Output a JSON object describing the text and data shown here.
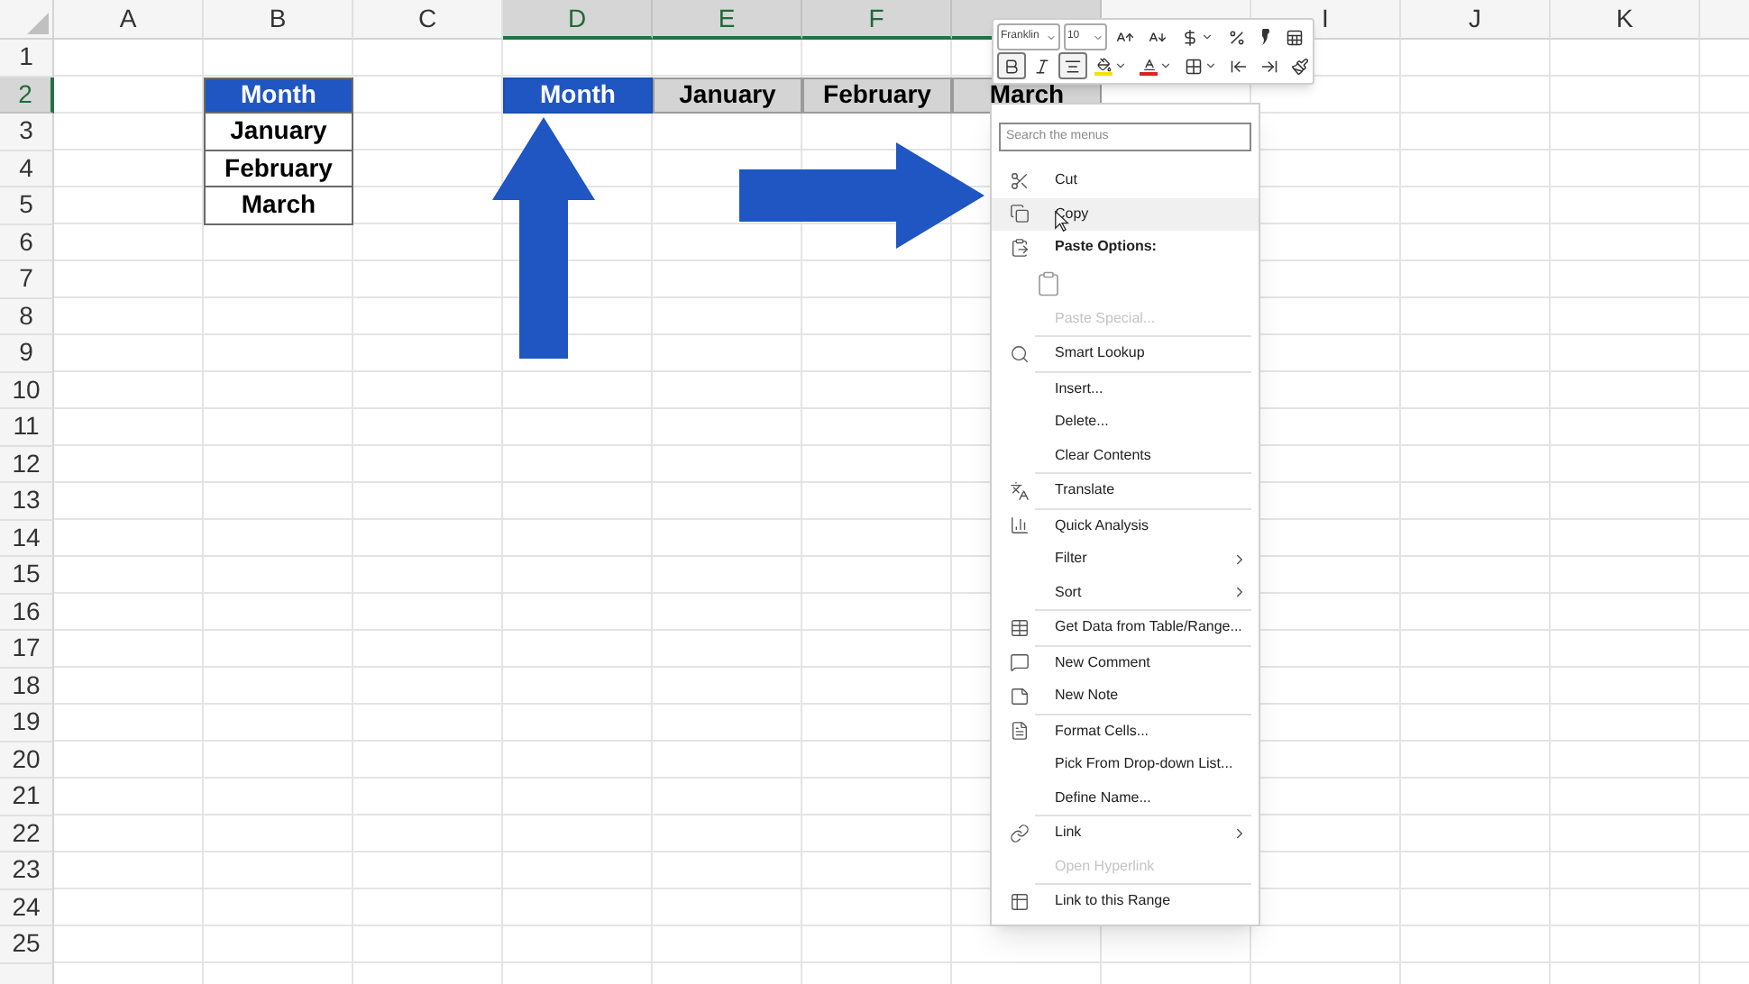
{
  "sheet": {
    "columns": [
      {
        "label": "A",
        "selected": false
      },
      {
        "label": "B",
        "selected": false
      },
      {
        "label": "C",
        "selected": false
      },
      {
        "label": "D",
        "selected": true
      },
      {
        "label": "E",
        "selected": true
      },
      {
        "label": "F",
        "selected": true
      },
      {
        "selected": true
      },
      {
        "selected": false
      },
      {
        "label": "I",
        "selected": false
      },
      {
        "label": "J",
        "selected": false
      },
      {
        "label": "K",
        "selected": false
      }
    ],
    "rows": [
      {
        "label": "1",
        "selected": false
      },
      {
        "label": "2",
        "selected": true,
        "cells": [
          {
            "kind": "empty"
          },
          {
            "kind": "header",
            "text": "Month"
          },
          {
            "kind": "empty"
          },
          {
            "kind": "active",
            "text": "Month"
          },
          {
            "kind": "transposed",
            "text": "January"
          },
          {
            "kind": "transposed",
            "text": "February"
          },
          {
            "kind": "transposed",
            "text": "March"
          }
        ]
      },
      {
        "label": "3",
        "selected": false,
        "cells": [
          {
            "kind": "empty"
          },
          {
            "kind": "item",
            "text": "January"
          }
        ]
      },
      {
        "label": "4",
        "selected": false,
        "cells": [
          {
            "kind": "empty"
          },
          {
            "kind": "item",
            "text": "February"
          }
        ]
      },
      {
        "label": "5",
        "selected": false,
        "cells": [
          {
            "kind": "empty"
          },
          {
            "kind": "item",
            "text": "March"
          }
        ]
      },
      {
        "label": "6",
        "selected": false
      },
      {
        "label": "7",
        "selected": false
      },
      {
        "label": "8",
        "selected": false
      },
      {
        "label": "9",
        "selected": false
      },
      {
        "label": "10",
        "selected": false
      },
      {
        "label": "11",
        "selected": false
      },
      {
        "label": "12",
        "selected": false
      },
      {
        "label": "13",
        "selected": false
      },
      {
        "label": "14",
        "selected": false
      },
      {
        "label": "15",
        "selected": false
      },
      {
        "label": "16",
        "selected": false
      },
      {
        "label": "17",
        "selected": false
      },
      {
        "label": "18",
        "selected": false
      },
      {
        "label": "19",
        "selected": false
      },
      {
        "label": "20",
        "selected": false
      },
      {
        "label": "21",
        "selected": false
      },
      {
        "label": "22",
        "selected": false
      },
      {
        "label": "23",
        "selected": false
      },
      {
        "label": "24",
        "selected": false
      },
      {
        "label": "25",
        "selected": false
      }
    ]
  },
  "mini_toolbar": {
    "font": "Franklin",
    "size": "10",
    "format_buttons": [
      {
        "selected": true
      },
      {
        "selected": false
      },
      {
        "selected": true
      }
    ]
  },
  "context_menu": {
    "search": {
      "placeholder": "Search the menus"
    },
    "items": [
      {
        "kind": "item",
        "label": "Cut",
        "selected": false,
        "disabled": false
      },
      {
        "kind": "item",
        "label": "Copy",
        "selected": true,
        "disabled": false
      },
      {
        "kind": "heading",
        "label": "Paste Options:"
      },
      {
        "kind": "paste-icons"
      },
      {
        "kind": "item",
        "label": "Paste Special...",
        "selected": false,
        "disabled": true
      },
      {
        "kind": "separator"
      },
      {
        "kind": "item",
        "label": "Smart Lookup",
        "selected": false,
        "disabled": false
      },
      {
        "kind": "separator"
      },
      {
        "kind": "item",
        "label": "Insert...",
        "selected": false,
        "disabled": false
      },
      {
        "kind": "item",
        "label": "Delete...",
        "selected": false,
        "disabled": false
      },
      {
        "kind": "item",
        "label": "Clear Contents",
        "selected": false,
        "disabled": false
      },
      {
        "kind": "separator"
      },
      {
        "kind": "item",
        "label": "Translate",
        "selected": false,
        "disabled": false
      },
      {
        "kind": "separator"
      },
      {
        "kind": "item",
        "label": "Quick Analysis",
        "selected": false,
        "disabled": false
      },
      {
        "kind": "item",
        "label": "Filter",
        "selected": false,
        "disabled": false,
        "submenu": true
      },
      {
        "kind": "item",
        "label": "Sort",
        "selected": false,
        "disabled": false,
        "submenu": true
      },
      {
        "kind": "separator"
      },
      {
        "kind": "item",
        "label": "Get Data from Table/Range...",
        "selected": false,
        "disabled": false
      },
      {
        "kind": "separator"
      },
      {
        "kind": "item",
        "label": "New Comment",
        "selected": false,
        "disabled": false
      },
      {
        "kind": "item",
        "label": "New Note",
        "selected": false,
        "disabled": false
      },
      {
        "kind": "separator"
      },
      {
        "kind": "item",
        "label": "Format Cells...",
        "selected": false,
        "disabled": false
      },
      {
        "kind": "item",
        "label": "Pick From Drop-down List...",
        "selected": false,
        "disabled": false
      },
      {
        "kind": "item",
        "label": "Define Name...",
        "selected": false,
        "disabled": false
      },
      {
        "kind": "separator"
      },
      {
        "kind": "item",
        "label": "Link",
        "selected": false,
        "disabled": false,
        "submenu": true
      },
      {
        "kind": "item",
        "label": "Open Hyperlink",
        "selected": false,
        "disabled": true
      },
      {
        "kind": "separator"
      },
      {
        "kind": "item",
        "label": "Link to this Range",
        "selected": false,
        "disabled": false
      }
    ]
  }
}
